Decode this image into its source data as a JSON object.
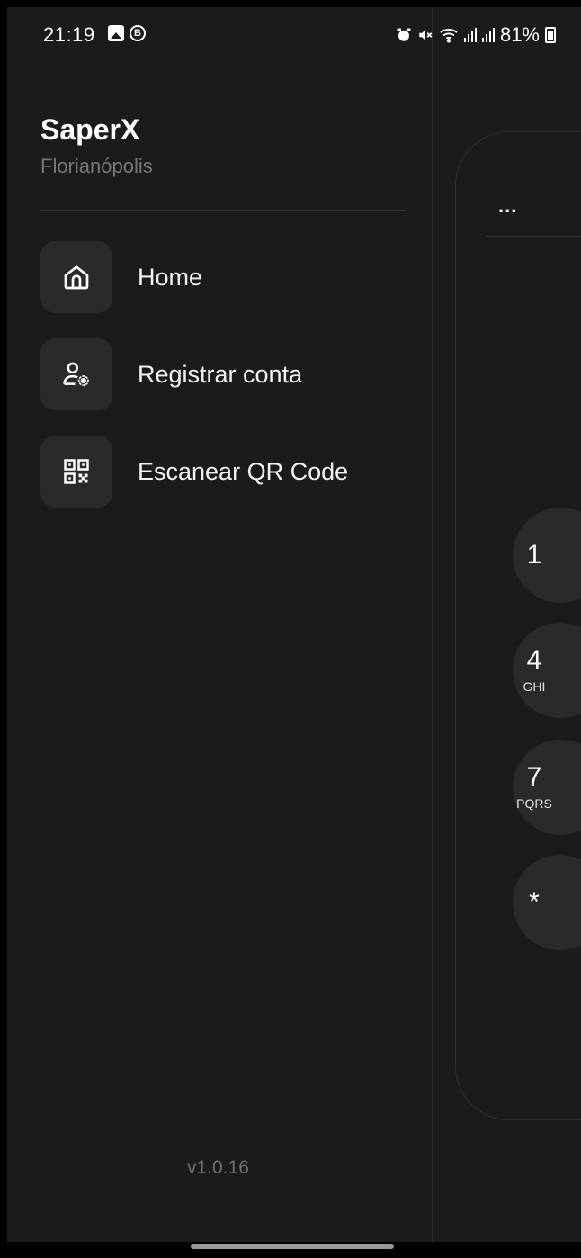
{
  "status_bar": {
    "time": "21:19",
    "b_badge": "B",
    "battery": "81%"
  },
  "drawer": {
    "title": "SaperX",
    "subtitle": "Florianópolis",
    "items": [
      {
        "label": "Home",
        "icon": "home-icon"
      },
      {
        "label": "Registrar conta",
        "icon": "user-settings-icon"
      },
      {
        "label": "Escanear QR Code",
        "icon": "qr-code-icon"
      }
    ],
    "version": "v1.0.16"
  },
  "background_dialer": {
    "menu": "...",
    "keys": [
      {
        "num": "1",
        "sub": ""
      },
      {
        "num": "4",
        "sub": "GHI"
      },
      {
        "num": "7",
        "sub": "PQRS"
      },
      {
        "num": "*",
        "sub": ""
      }
    ]
  },
  "colors": {
    "background": "#1b1b1d",
    "icon_box": "#2a2a2d",
    "muted_text": "#77777c"
  }
}
